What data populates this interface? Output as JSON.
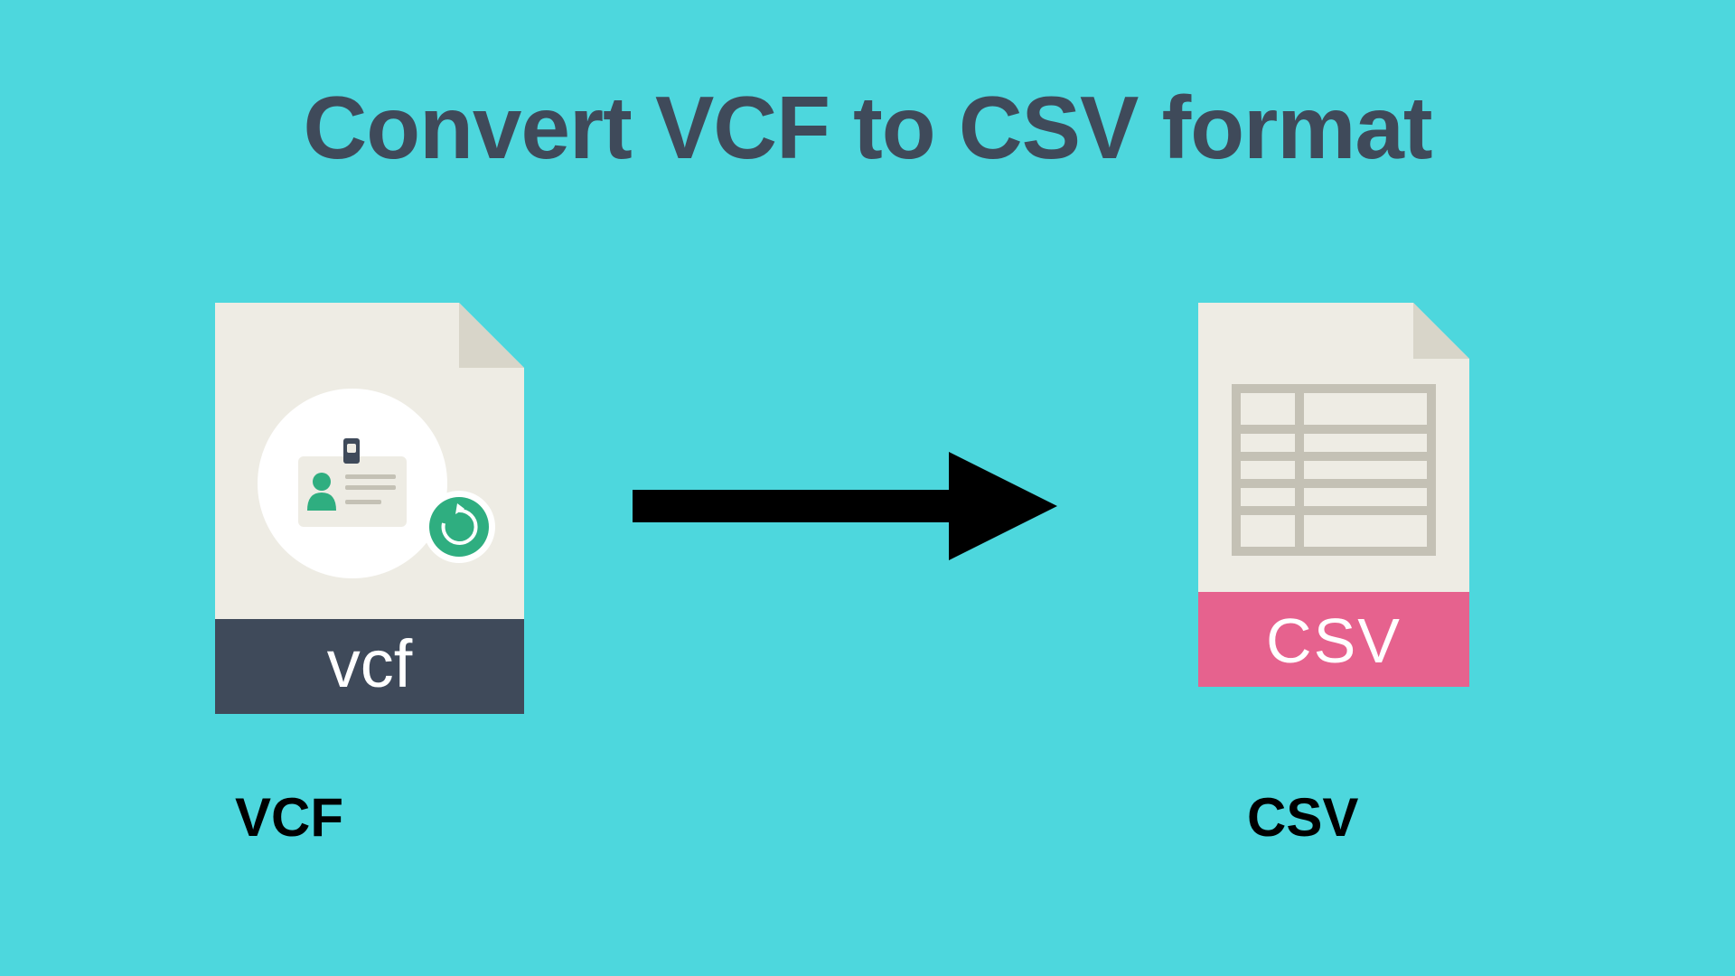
{
  "title": "Convert VCF to CSV format",
  "icons": {
    "vcf_label": "vcf",
    "csv_label": "CSV"
  },
  "labels": {
    "vcf": "VCF",
    "csv": "CSV"
  },
  "colors": {
    "background": "#4dd7dd",
    "title": "#3f4a5a",
    "vcf_footer": "#3f4a5a",
    "csv_footer": "#e6628e",
    "file_body": "#eeece4",
    "file_corner": "#d8d5c9",
    "vcf_inner_circle": "#ffffff",
    "vcf_badge_green": "#2fae80",
    "csv_grid": "#c4c1b5"
  }
}
